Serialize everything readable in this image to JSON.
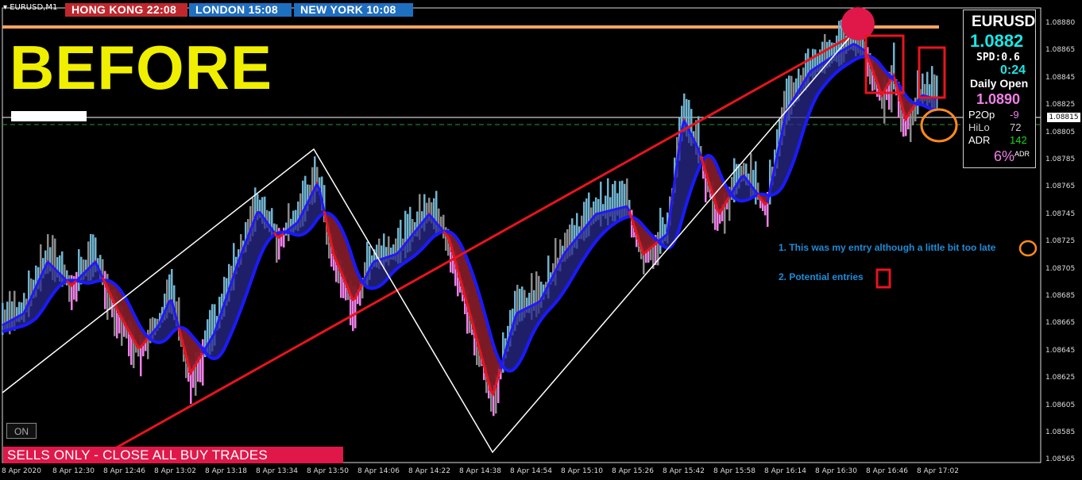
{
  "symbol_tab": "EURUSD,M1",
  "clocks": [
    {
      "label": "HONG KONG 22:08",
      "color": "#c0272d"
    },
    {
      "label": "LONDON    15:08",
      "color": "#1f6fc0"
    },
    {
      "label": "NEW YORK  10:08",
      "color": "#1f6fc0"
    }
  ],
  "title_text": "BEFORE",
  "info_panel": {
    "pair": "EURUSD",
    "price": "1.0882",
    "spread": "SPD:0.6",
    "timer": "0:24",
    "daily_open_label": "Daily Open",
    "daily_open": "1.0890",
    "p2op_label": "P2Op",
    "p2op": "-9",
    "hilo_label": "HiLo",
    "hilo": "72",
    "adr_label": "ADR",
    "adr": "142",
    "pct": "6%",
    "adr_small": "ADR"
  },
  "price_axis": [
    "1.08880",
    "1.08865",
    "1.08845",
    "1.08825",
    "1.08805",
    "1.08785",
    "1.08765",
    "1.08745",
    "1.08725",
    "1.08705",
    "1.08685",
    "1.08665",
    "1.08645",
    "1.08625",
    "1.08605",
    "1.08585",
    "1.08565"
  ],
  "current_price_tag": "1.08815",
  "time_axis": [
    "8 Apr 2020",
    "8 Apr 12:30",
    "8 Apr 12:46",
    "8 Apr 13:02",
    "8 Apr 13:18",
    "8 Apr 13:34",
    "8 Apr 13:50",
    "8 Apr 14:06",
    "8 Apr 14:22",
    "8 Apr 14:38",
    "8 Apr 14:54",
    "8 Apr 15:10",
    "8 Apr 15:26",
    "8 Apr 15:42",
    "8 Apr 15:58",
    "8 Apr 16:14",
    "8 Apr 16:30",
    "8 Apr 16:46",
    "8 Apr 17:02"
  ],
  "legend": {
    "item1": "1. This was my entry although a little bit too late",
    "item2": "2. Potential entries"
  },
  "on_button": "ON",
  "banner": "SELLS ONLY - CLOSE ALL BUY TRADES",
  "colors": {
    "orange_line": "#f4a460",
    "red_channel": "#e8141e",
    "blue_ma": "#1a1aff",
    "red_ma": "#e8141e",
    "fill_bull": "#2a2a8c",
    "fill_bear": "#8a1a1a",
    "up_bar": "#6fb3d0",
    "down_bar": "#f080e8",
    "neutral_bar": "#8a8a8a"
  }
}
